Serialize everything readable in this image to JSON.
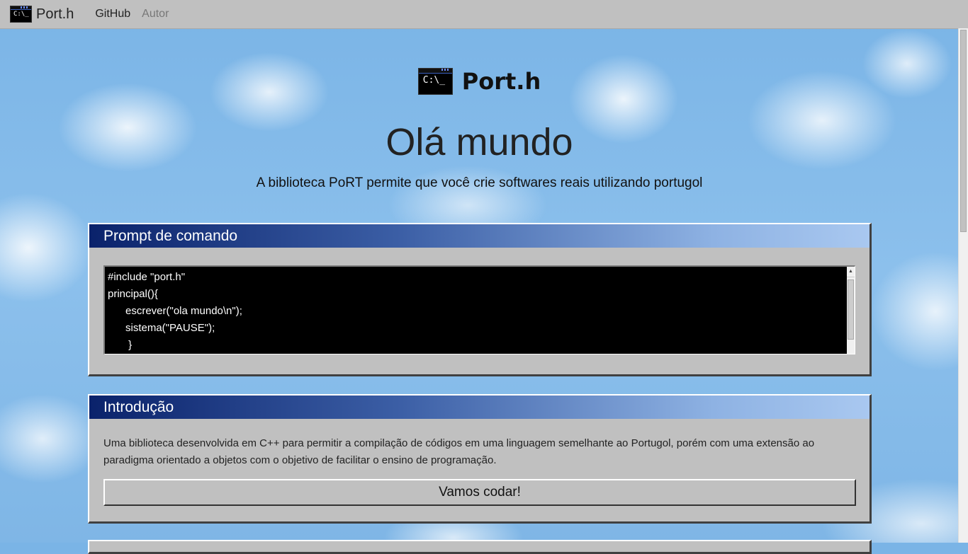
{
  "navbar": {
    "icon_text": "C:\\_",
    "brand": "Port.h",
    "links": [
      "GitHub",
      "Autor"
    ]
  },
  "hero": {
    "icon_text": "C:\\_",
    "brand": "Port.h",
    "title": "Olá mundo",
    "subtitle": "A biblioteca PoRT permite que você crie softwares reais utilizando portugol"
  },
  "prompt_panel": {
    "title": "Prompt de comando",
    "code_lines": [
      "#include \"port.h\"",
      "principal(){",
      "      escrever(\"ola mundo\\n\");",
      "      sistema(\"PAUSE\");",
      "       }"
    ]
  },
  "intro_panel": {
    "title": "Introdução",
    "text": "Uma biblioteca desenvolvida em C++ para permitir a compilação de códigos em uma linguagem semelhante ao Portugol, porém com uma extensão ao paradigma orientado a objetos com o objetivo de facilitar o ensino de programação.",
    "button_label": "Vamos codar!"
  },
  "colors": {
    "panel_bg": "#c0c0c0",
    "header_gradient_start": "#0a226b",
    "header_gradient_end": "#a9c8f0",
    "sky": "#7ab4e6"
  }
}
